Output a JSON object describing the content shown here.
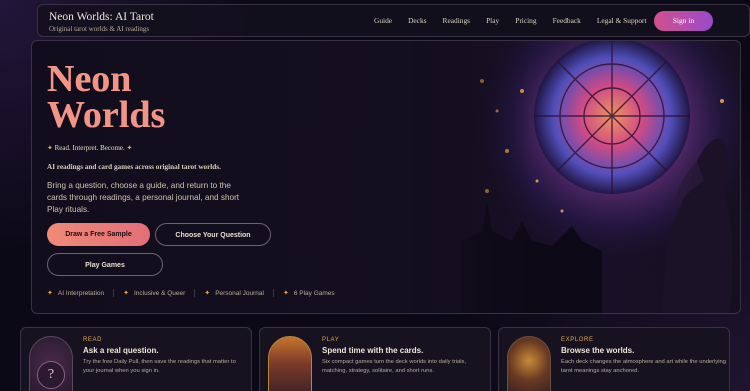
{
  "brand": {
    "title": "Neon Worlds: AI Tarot",
    "subtitle": "Original tarot worlds & AI readings"
  },
  "nav": {
    "items": [
      "Guide",
      "Decks",
      "Readings",
      "Play",
      "Pricing",
      "Feedback",
      "Legal & Support"
    ],
    "signin_label": "Sign in"
  },
  "hero": {
    "title_line1": "Neon",
    "title_line2": "Worlds",
    "tagline": "Read. Interpret. Become.",
    "subline": "AI readings and card games across original tarot worlds.",
    "description": "Bring a question, choose a guide, and return to the cards through readings, a personal journal, and short Play rituals.",
    "primary_button": "Draw a Free Sample",
    "question_button": "Choose Your Question",
    "play_button": "Play Games",
    "features": [
      "AI Interpretation",
      "Inclusive & Queer",
      "Personal Journal",
      "6 Play Games"
    ]
  },
  "cards": [
    {
      "kicker": "READ",
      "title": "Ask a real question.",
      "desc": "Try the free Daily Pull, then save the readings that matter to your journal when you sign in.",
      "icon": "question-mark-icon"
    },
    {
      "kicker": "PLAY",
      "title": "Spend time with the cards.",
      "desc": "Six compact games turn the deck worlds into daily trials, matching, strategy, solitaire, and short runs."
    },
    {
      "kicker": "EXPLORE",
      "title": "Browse the worlds.",
      "desc": "Each deck changes the atmosphere and art while the underlying tarot meanings stay anchored."
    }
  ],
  "colors": {
    "accent": "#f08a77",
    "gold": "#e6a94f",
    "signin_from": "#d2508c",
    "signin_to": "#9a4acb",
    "background": "#0c0916"
  }
}
